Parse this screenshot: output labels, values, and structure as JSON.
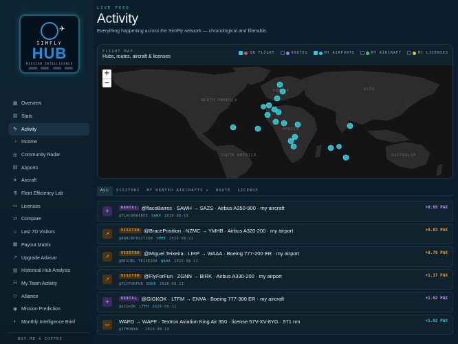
{
  "sidebar": {
    "logo": {
      "top": "SIMFLY",
      "main": "HUB",
      "sub": "MISSION INTELLIGENCE"
    },
    "items": [
      {
        "label": "Overview",
        "icon": "grid-icon",
        "glyph": "▦"
      },
      {
        "label": "Stats",
        "icon": "bar-chart-icon",
        "glyph": "▥"
      },
      {
        "label": "Activity",
        "icon": "activity-icon",
        "glyph": "∿",
        "active": true
      },
      {
        "label": "Income",
        "icon": "dollar-icon",
        "glyph": "◔"
      },
      {
        "label": "Community Radar",
        "icon": "radar-icon",
        "glyph": "◎"
      },
      {
        "label": "Airports",
        "icon": "airport-icon",
        "glyph": "▤"
      },
      {
        "label": "Aircraft",
        "icon": "plane-icon",
        "glyph": "✈"
      },
      {
        "label": "Fleet Efficiency Lab",
        "icon": "lab-icon",
        "glyph": "⚗"
      },
      {
        "label": "Licenses",
        "icon": "license-icon",
        "glyph": "▭"
      },
      {
        "label": "Compare",
        "icon": "compare-icon",
        "glyph": "⇄"
      },
      {
        "label": "Last 7D Visitors",
        "icon": "visitors-icon",
        "glyph": "☺"
      },
      {
        "label": "Payout Matrix",
        "icon": "matrix-icon",
        "glyph": "▦"
      },
      {
        "label": "Upgrade Advisor",
        "icon": "upgrade-icon",
        "glyph": "↗"
      },
      {
        "label": "Historical Hub Analysis",
        "icon": "history-icon",
        "glyph": "▥"
      },
      {
        "label": "My Team Activity",
        "icon": "team-icon",
        "glyph": "☷"
      },
      {
        "label": "Alliance",
        "icon": "alliance-icon",
        "glyph": "◇"
      },
      {
        "label": "Mission Prediction",
        "icon": "target-icon",
        "glyph": "◉"
      },
      {
        "label": "Monthly Intelligence Brief",
        "icon": "brief-icon",
        "glyph": "◐"
      }
    ],
    "coffee": "BUY ME A COFFEE"
  },
  "header": {
    "kicker": "LIVE FEED",
    "title": "Activity",
    "subtitle": "Everything happening across the SimFly network — chronological and filterable."
  },
  "map": {
    "kicker": "FLIGHT MAP",
    "title": "Hubs, routes, aircraft & licenses",
    "zoom_in": "+",
    "zoom_out": "−",
    "legend": [
      {
        "label": "IN FLIGHT",
        "color": "#e84b4b",
        "checked": true
      },
      {
        "label": "ROUTES",
        "color": "#9b7cf0",
        "checked": false
      },
      {
        "label": "MY AIRPORTS",
        "color": "#2ec8da",
        "checked": true
      },
      {
        "label": "MY AIRCRAFT",
        "color": "#3fcf6a",
        "checked": false
      },
      {
        "label": "MY LICENSES",
        "color": "#f0c23a",
        "checked": false
      }
    ],
    "labels": [
      "NORTH AMERICA",
      "EUROPE",
      "ASIA",
      "AFRICA",
      "SOUTH AMERICA",
      "AUSTRALIA"
    ]
  },
  "tabs": [
    "ALL",
    "VISITORS",
    "MY RENTED AIRCRAFTS ✈",
    "ROUTE",
    "LICENSE"
  ],
  "feed": [
    {
      "icon": "rental-icon",
      "glyph": "✈",
      "badge_bg": "#3a2a5e",
      "badge_fg": "#c79bff",
      "tag": "RENTAL",
      "tag_color": "#c79bff",
      "tag_bg": "#3a2a5e",
      "text": "@flacoBaires · SAWH → SAZS · Airbus A350-900 · my aircraft",
      "user": "@FLACOBAIRES",
      "code": "SAWH",
      "date": "2026-08-11",
      "pax": "+0.69 PAX",
      "pax_color": "#c79bff"
    },
    {
      "icon": "visitor-icon",
      "glyph": "↗",
      "badge_bg": "#4a3416",
      "badge_fg": "#f0a53a",
      "tag": "VISITOR",
      "tag_color": "#f0a53a",
      "tag_bg": "#4a3416",
      "text": "@BracePosition · NZMC → YMHB · Airbus A320-200 · my airport",
      "user": "@BRACEPOSITION",
      "code": "YMHB",
      "date": "2026-08-11",
      "pax": "+0.83 PAX",
      "pax_color": "#f0a53a"
    },
    {
      "icon": "visitor-icon",
      "glyph": "↗",
      "badge_bg": "#4a3416",
      "badge_fg": "#f0a53a",
      "tag": "VISITOR",
      "tag_color": "#f0a53a",
      "tag_bg": "#4a3416",
      "text": "@Miguel Teixeira · LIRP → WAAA · Boeing 777-200 ER · my airport",
      "user": "@MIGUEL TEIXEIRA",
      "code": "WAAA",
      "date": "2026-08-11",
      "pax": "+0.78 PAX",
      "pax_color": "#f0a53a"
    },
    {
      "icon": "visitor-icon",
      "glyph": "↗",
      "badge_bg": "#4a3416",
      "badge_fg": "#f0a53a",
      "tag": "VISITOR",
      "tag_color": "#f0a53a",
      "tag_bg": "#4a3416",
      "text": "@FlyForFun · ZGNN → BIRK · Airbus A330-200 · my airport",
      "user": "@FLYFORFUN",
      "code": "BIRK",
      "date": "2026-08-11",
      "pax": "+1.17 PAX",
      "pax_color": "#f0a53a"
    },
    {
      "icon": "rental-icon",
      "glyph": "✈",
      "badge_bg": "#3a2a5e",
      "badge_fg": "#c79bff",
      "tag": "RENTAL",
      "tag_color": "#c79bff",
      "tag_bg": "#3a2a5e",
      "text": "@GIGKOK · LTFM → ENVA · Boeing 777-300 ER · my aircraft",
      "user": "@GIGKOK",
      "code": "LTFM",
      "date": "2026-08-11",
      "pax": "+1.02 PAX",
      "pax_color": "#c79bff"
    },
    {
      "icon": "license-icon",
      "glyph": "▭",
      "badge_bg": "#4a3416",
      "badge_fg": "#f0a53a",
      "tag": "",
      "tag_color": "",
      "tag_bg": "",
      "text": "WAPD → WAPF · Textron Aviation King Air 350 · license 57V-XV-8YG · 571 nm",
      "user": "@SYMONXA",
      "code": "",
      "date": "2026-08-10",
      "pax": "+1.02 PAX",
      "pax_color": "#2ec8da"
    }
  ]
}
